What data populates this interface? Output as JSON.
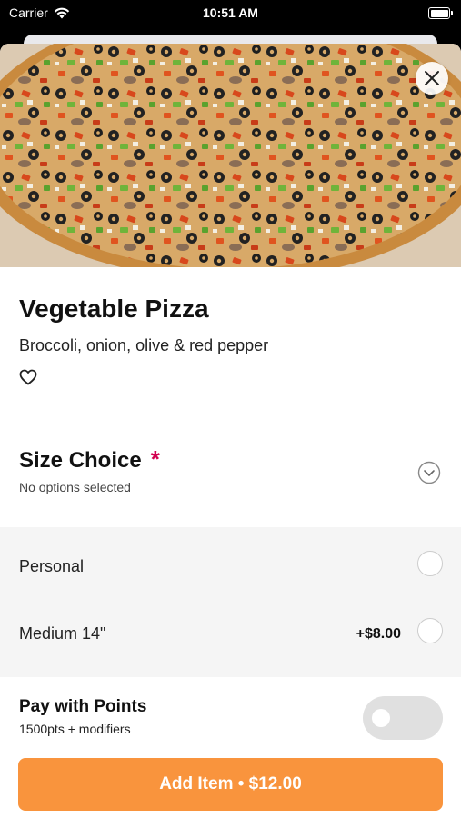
{
  "status_bar": {
    "carrier": "Carrier",
    "time": "10:51 AM",
    "icons": [
      "wifi-icon",
      "battery-icon"
    ]
  },
  "item": {
    "title": "Vegetable Pizza",
    "description": "Broccoli, onion, olive & red pepper",
    "image": "vegetable-pizza-photo",
    "close_icon": "close-icon",
    "favorite_icon": "heart-icon"
  },
  "size_choice": {
    "title": "Size Choice",
    "required_marker": "*",
    "subtitle": "No options selected",
    "expand_icon": "chevron-down-icon",
    "options": [
      {
        "label": "Personal",
        "price": ""
      },
      {
        "label": "Medium 14\"",
        "price": "+$8.00"
      }
    ]
  },
  "points": {
    "title": "Pay with Points",
    "subtitle": "1500pts + modifiers",
    "enabled": false
  },
  "add_button": {
    "label": "Add Item • $12.00"
  },
  "colors": {
    "accent": "#f9943d",
    "required": "#d2004f",
    "options_bg": "#f5f5f5"
  }
}
